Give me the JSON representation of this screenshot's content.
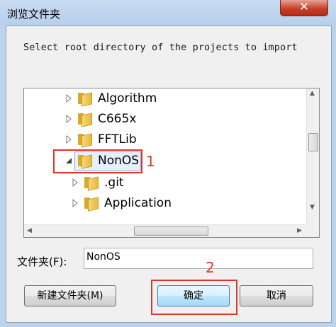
{
  "window": {
    "title": "浏览文件夹",
    "close_label": "✕"
  },
  "description": "Select root directory of the projects to import",
  "tree": {
    "items": [
      {
        "label": "Algorithm",
        "expanded": false
      },
      {
        "label": "C665x",
        "expanded": false
      },
      {
        "label": "FFTLib",
        "expanded": false
      },
      {
        "label": "NonOS",
        "expanded": true,
        "selected": true
      },
      {
        "label": ".git",
        "expanded": false
      },
      {
        "label": "Application",
        "expanded": false
      }
    ]
  },
  "folder_field": {
    "label": "文件夹(F):",
    "value": "NonOS"
  },
  "buttons": {
    "new_folder": "新建文件夹(M)",
    "ok": "确定",
    "cancel": "取消"
  },
  "annotations": {
    "marker_1": "1",
    "marker_2": "2"
  },
  "colors": {
    "annotation_red": "#e0342b",
    "selection_bg": "#e5f0fb",
    "folder_yellow": "#f6d77a"
  }
}
